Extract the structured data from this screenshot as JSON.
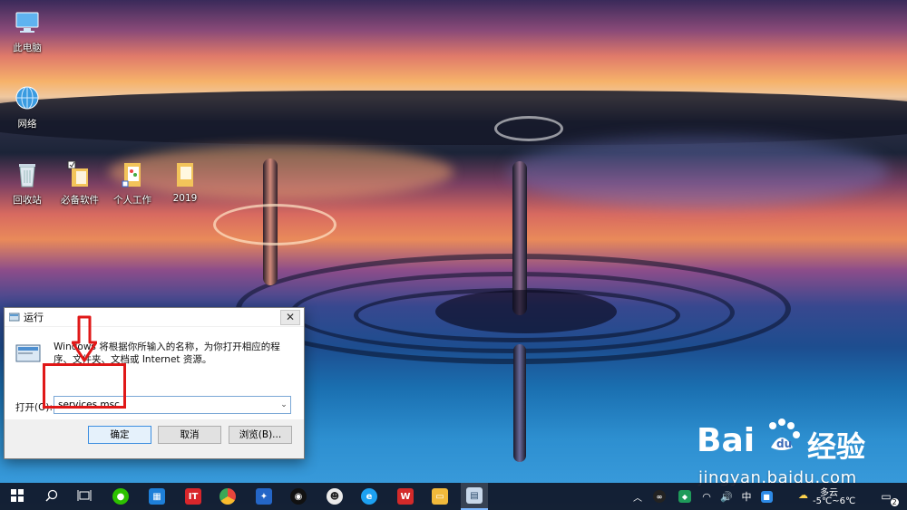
{
  "desktop": {
    "icons": [
      {
        "label": "此电脑",
        "icon": "computer-icon"
      },
      {
        "label": "网络",
        "icon": "network-icon"
      },
      {
        "label": "回收站",
        "icon": "recycle-bin-icon"
      },
      {
        "label": "必备软件",
        "icon": "folder-icon"
      },
      {
        "label": "个人工作",
        "icon": "folder-icon"
      },
      {
        "label": "2019",
        "icon": "folder-icon"
      }
    ]
  },
  "run_dialog": {
    "title": "运行",
    "description": "Windows 将根据你所输入的名称，为你打开相应的程序、文件夹、文档或 Internet 资源。",
    "open_label": "打开(O):",
    "input_value": "services.msc",
    "buttons": {
      "ok": "确定",
      "cancel": "取消",
      "browse": "浏览(B)..."
    }
  },
  "watermark": {
    "logo_text": "Bai",
    "logo_suffix": "经验",
    "url": "jingyan.baidu.com"
  },
  "taskbar": {
    "apps": [
      "wechat-icon",
      "calculator-icon",
      "it-app-icon",
      "chrome-icon",
      "app-store-icon",
      "qq-icon",
      "alien-icon",
      "ie-icon",
      "wps-icon",
      "file-explorer-icon",
      "run-dialog-icon"
    ],
    "tray": {
      "ime": "中",
      "weather_text": "多云",
      "temperature": "-5℃~6℃",
      "notification_count": "2"
    }
  },
  "colors": {
    "highlight_red": "#e01818",
    "taskbar_bg": "#101626",
    "button_primary_border": "#3c8ee0"
  }
}
